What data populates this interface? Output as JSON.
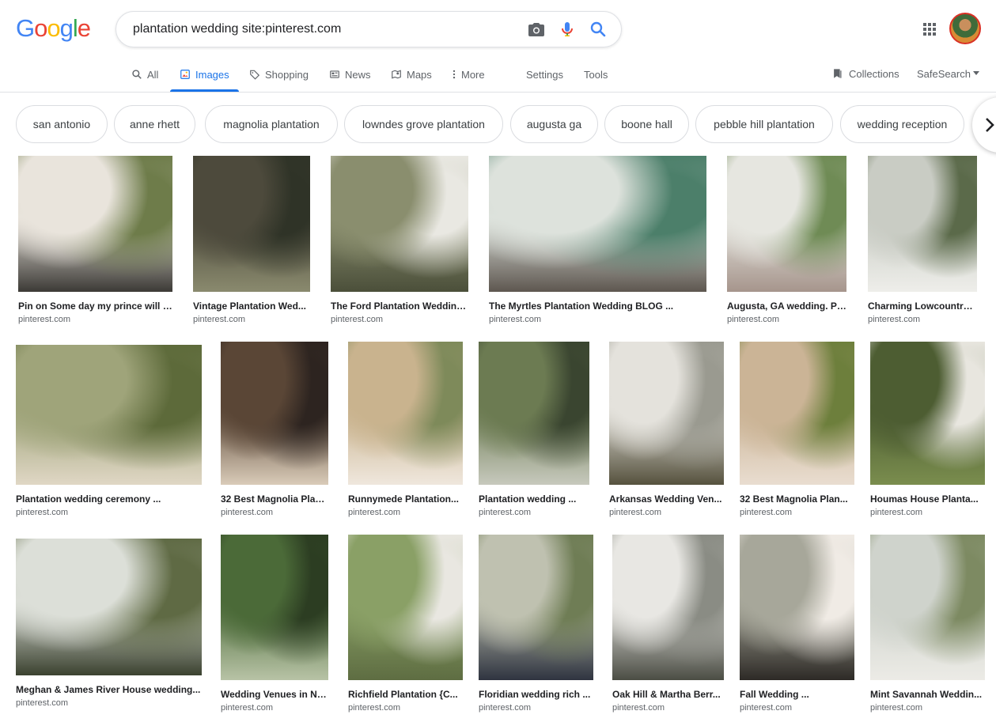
{
  "logo": "Google",
  "search": {
    "query": "plantation wedding site:pinterest.com"
  },
  "tabs": {
    "all": "All",
    "images": "Images",
    "shopping": "Shopping",
    "news": "News",
    "maps": "Maps",
    "more": "More",
    "settings": "Settings",
    "tools": "Tools",
    "collections": "Collections",
    "safesearch": "SafeSearch"
  },
  "chips": [
    "san antonio",
    "anne rhett",
    "magnolia plantation",
    "lowndes grove plantation",
    "augusta ga",
    "boone hall",
    "pebble hill plantation",
    "wedding reception"
  ],
  "results": [
    {
      "caption": "Pin on Some day my prince will c...",
      "source": "pinterest.com",
      "colors": [
        "#e9e4dc",
        "#6e7c4a",
        "#3c3a36"
      ]
    },
    {
      "caption": "Vintage Plantation Wed...",
      "source": "pinterest.com",
      "colors": [
        "#4d4a3c",
        "#2f3327",
        "#8a8a6e"
      ]
    },
    {
      "caption": "The Ford Plantation Wedding...",
      "source": "pinterest.com",
      "colors": [
        "#8a8e6e",
        "#e9e8e2",
        "#4b4f3a"
      ]
    },
    {
      "caption": "The Myrtles Plantation Wedding BLOG ...",
      "source": "pinterest.com",
      "colors": [
        "#dde2dc",
        "#4c7f6a",
        "#5e5750"
      ]
    },
    {
      "caption": "Augusta, GA wedding. Pl...",
      "source": "pinterest.com",
      "colors": [
        "#e6e6e0",
        "#6f8b55",
        "#a6958c"
      ]
    },
    {
      "caption": "Charming Lowcountry ...",
      "source": "pinterest.com",
      "colors": [
        "#c9ccc4",
        "#5b6a4a",
        "#eeeeea"
      ]
    },
    {
      "caption": "Plantation wedding ceremony ...",
      "source": "pinterest.com",
      "colors": [
        "#9fa47a",
        "#5d6a3a",
        "#e0d7c5"
      ]
    },
    {
      "caption": "32 Best Magnolia Plan...",
      "source": "pinterest.com",
      "colors": [
        "#5a4636",
        "#2d2420",
        "#d9cbb8"
      ]
    },
    {
      "caption": "Runnymede Plantation...",
      "source": "pinterest.com",
      "colors": [
        "#c9b38e",
        "#7e8a5a",
        "#efe7dd"
      ]
    },
    {
      "caption": "Plantation wedding ...",
      "source": "pinterest.com",
      "colors": [
        "#6c7b52",
        "#3a4530",
        "#c7c9bd"
      ]
    },
    {
      "caption": "Arkansas Wedding Ven...",
      "source": "pinterest.com",
      "colors": [
        "#e4e2dc",
        "#9a9a90",
        "#56523e"
      ]
    },
    {
      "caption": "32 Best Magnolia Plan...",
      "source": "pinterest.com",
      "colors": [
        "#cbb496",
        "#6d7f3c",
        "#e9ddd0"
      ]
    },
    {
      "caption": "Houmas House Planta...",
      "source": "pinterest.com",
      "colors": [
        "#4d5d32",
        "#e8e6df",
        "#7a8d4e"
      ]
    },
    {
      "caption": "Meghan & James River House wedding...",
      "source": "pinterest.com",
      "colors": [
        "#dcdfd8",
        "#5f6a44",
        "#3b4230"
      ]
    },
    {
      "caption": "Wedding Venues in Na...",
      "source": "pinterest.com",
      "colors": [
        "#4b6a38",
        "#2c3d22",
        "#b8c3a6"
      ]
    },
    {
      "caption": "Richfield Plantation {C...",
      "source": "pinterest.com",
      "colors": [
        "#8aa066",
        "#e9e7e1",
        "#5e6d42"
      ]
    },
    {
      "caption": "Floridian wedding rich ...",
      "source": "pinterest.com",
      "colors": [
        "#bfc1b0",
        "#6f7d55",
        "#2f3440"
      ]
    },
    {
      "caption": "Oak Hill & Martha Berr...",
      "source": "pinterest.com",
      "colors": [
        "#e8e7e3",
        "#8a8c84",
        "#4b4d44"
      ]
    },
    {
      "caption": "Fall Wedding ...",
      "source": "pinterest.com",
      "colors": [
        "#a7a79a",
        "#f0ebe5",
        "#2d2a26"
      ]
    },
    {
      "caption": "Mint Savannah Weddin...",
      "source": "pinterest.com",
      "colors": [
        "#cfd3cc",
        "#7d8a62",
        "#ecebe6"
      ]
    }
  ]
}
